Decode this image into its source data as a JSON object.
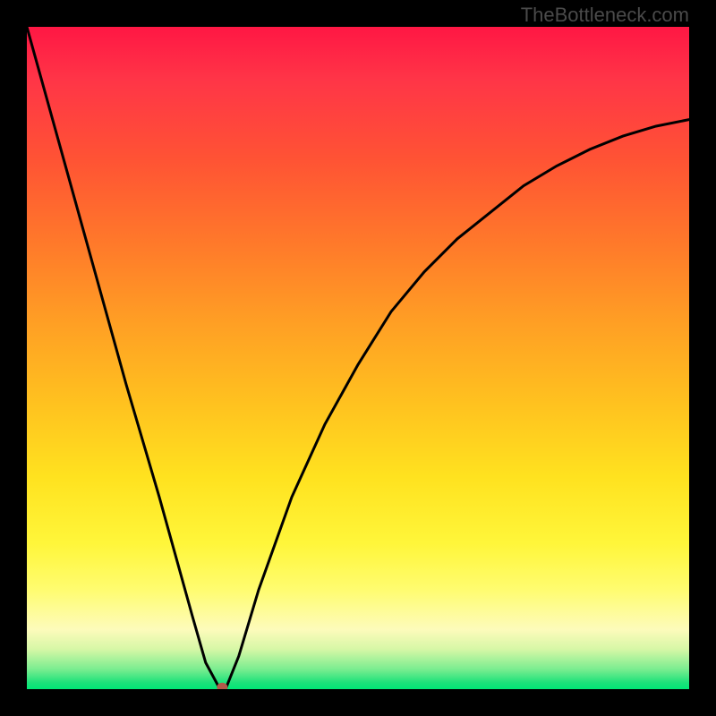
{
  "watermark": "TheBottleneck.com",
  "chart_data": {
    "type": "line",
    "title": "",
    "xlabel": "",
    "ylabel": "",
    "xlim": [
      0,
      100
    ],
    "ylim": [
      0,
      100
    ],
    "grid": false,
    "legend": false,
    "background_gradient": {
      "orientation": "vertical",
      "stops": [
        {
          "pos": 0,
          "color": "#ff1744"
        },
        {
          "pos": 50,
          "color": "#ffc21f"
        },
        {
          "pos": 85,
          "color": "#fffc70"
        },
        {
          "pos": 100,
          "color": "#00e676"
        }
      ]
    },
    "series": [
      {
        "name": "curve",
        "x": [
          0,
          5,
          10,
          15,
          20,
          25,
          27,
          29,
          30,
          32,
          35,
          40,
          45,
          50,
          55,
          60,
          65,
          70,
          75,
          80,
          85,
          90,
          95,
          100
        ],
        "values": [
          100,
          82,
          64,
          46,
          29,
          11,
          4,
          0.3,
          0,
          5,
          15,
          29,
          40,
          49,
          57,
          63,
          68,
          72,
          76,
          79,
          81.5,
          83.5,
          85,
          86
        ]
      }
    ],
    "marker": {
      "x": 29.5,
      "y": 0.3
    }
  }
}
